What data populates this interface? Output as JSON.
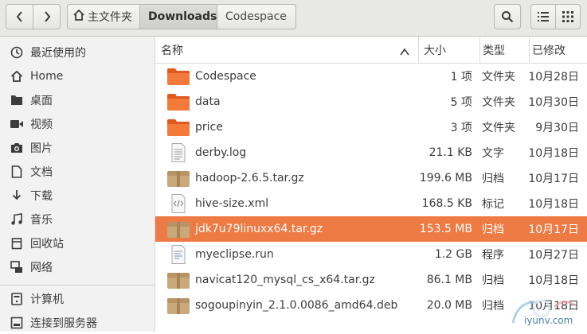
{
  "header": {
    "breadcrumb": [
      "主文件夹",
      "Downloads",
      "Codespace"
    ]
  },
  "sidebar": {
    "items": [
      {
        "label": "最近使用的",
        "icon": "clock-icon"
      },
      {
        "label": "Home",
        "icon": "home-icon"
      },
      {
        "label": "桌面",
        "icon": "folder-icon"
      },
      {
        "label": "视频",
        "icon": "video-icon"
      },
      {
        "label": "图片",
        "icon": "camera-icon"
      },
      {
        "label": "文档",
        "icon": "document-icon"
      },
      {
        "label": "下载",
        "icon": "download-icon"
      },
      {
        "label": "音乐",
        "icon": "music-icon"
      },
      {
        "label": "回收站",
        "icon": "trash-icon"
      },
      {
        "label": "网络",
        "icon": "network-icon"
      },
      {
        "label": "计算机",
        "icon": "computer-icon"
      },
      {
        "label": "连接到服务器",
        "icon": "server-icon"
      }
    ]
  },
  "columns": {
    "name": "名称",
    "size": "大小",
    "type": "类型",
    "modified": "已修改"
  },
  "files": [
    {
      "name": "Codespace",
      "size": "1 项",
      "type": "文件夹",
      "modified": "10月28日",
      "icon": "folder-icon"
    },
    {
      "name": "data",
      "size": "5 项",
      "type": "文件夹",
      "modified": "10月30日",
      "icon": "folder-icon"
    },
    {
      "name": "price",
      "size": "3 项",
      "type": "文件夹",
      "modified": "9月30日",
      "icon": "folder-icon"
    },
    {
      "name": "derby.log",
      "size": "21.1 KB",
      "type": "文字",
      "modified": "10月18日",
      "icon": "text-file-icon"
    },
    {
      "name": "hadoop-2.6.5.tar.gz",
      "size": "199.6 MB",
      "type": "归档",
      "modified": "10月17日",
      "icon": "archive-icon"
    },
    {
      "name": "hive-size.xml",
      "size": "168.5 KB",
      "type": "标记",
      "modified": "10月18日",
      "icon": "markup-file-icon"
    },
    {
      "name": "jdk7u79linuxx64.tar.gz",
      "size": "153.5 MB",
      "type": "归档",
      "modified": "10月17日",
      "icon": "archive-icon",
      "selected": true
    },
    {
      "name": "myeclipse.run",
      "size": "1.2 GB",
      "type": "程序",
      "modified": "10月27日",
      "icon": "script-file-icon"
    },
    {
      "name": "navicat120_mysql_cs_x64.tar.gz",
      "size": "86.1 MB",
      "type": "归档",
      "modified": "10月18日",
      "icon": "archive-icon"
    },
    {
      "name": "sogoupinyin_2.1.0.0086_amd64.deb",
      "size": "20.0 MB",
      "type": "归档",
      "modified": "10月18日",
      "icon": "archive-icon"
    }
  ],
  "watermark": "iyunv.com",
  "colors": {
    "selection": "#ee7a44",
    "folder": "#ef6f2e",
    "archive": "#c9a879"
  }
}
